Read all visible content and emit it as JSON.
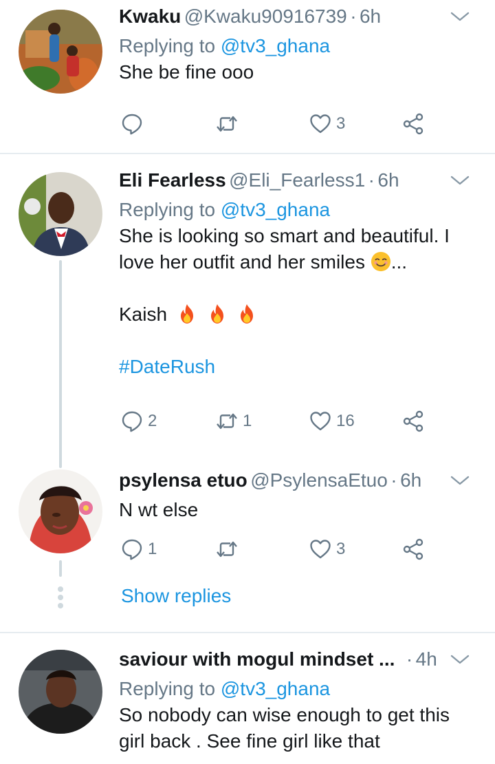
{
  "colors": {
    "accent": "#1b95e0",
    "muted": "#657786",
    "text": "#14171a",
    "divider": "#e6ecf0"
  },
  "tweets": [
    {
      "name": "Kwaku",
      "handle": "@Kwaku90916739",
      "dot": "·",
      "time": "6h",
      "replying_prefix": "Replying to",
      "replying_to": "@tv3_ghana",
      "text": "She be fine ooo",
      "replies": "",
      "retweets": "",
      "likes": "3"
    },
    {
      "name": "Eli Fearless",
      "handle": "@Eli_Fearless1",
      "dot": "·",
      "time": "6h",
      "replying_prefix": "Replying to",
      "replying_to": "@tv3_ghana",
      "text_line1": "She is looking so smart and beautiful. I",
      "text_line2": "love her outfit and her smiles",
      "ellipsis": "...",
      "text_line3": "Kaish",
      "hashtag": "#DateRush",
      "replies": "2",
      "retweets": "1",
      "likes": "16"
    },
    {
      "name": "psylensa etuo",
      "handle": "@PsylensaEtuo",
      "dot": "·",
      "time": "6h",
      "text": "N wt else",
      "replies": "1",
      "retweets": "",
      "likes": "3"
    },
    {
      "name": "saviour with mogul mindset ...",
      "dot": "·",
      "time": "4h",
      "replying_prefix": "Replying to",
      "replying_to": "@tv3_ghana",
      "text_line1": "So nobody can wise enough to get this",
      "text_line2": "girl back . See fine girl like that"
    }
  ],
  "show_replies": "Show replies",
  "icons": [
    "reply-icon",
    "retweet-icon",
    "like-icon",
    "share-icon",
    "chevron-down-icon",
    "fire-emoji",
    "smiling-emoji"
  ]
}
